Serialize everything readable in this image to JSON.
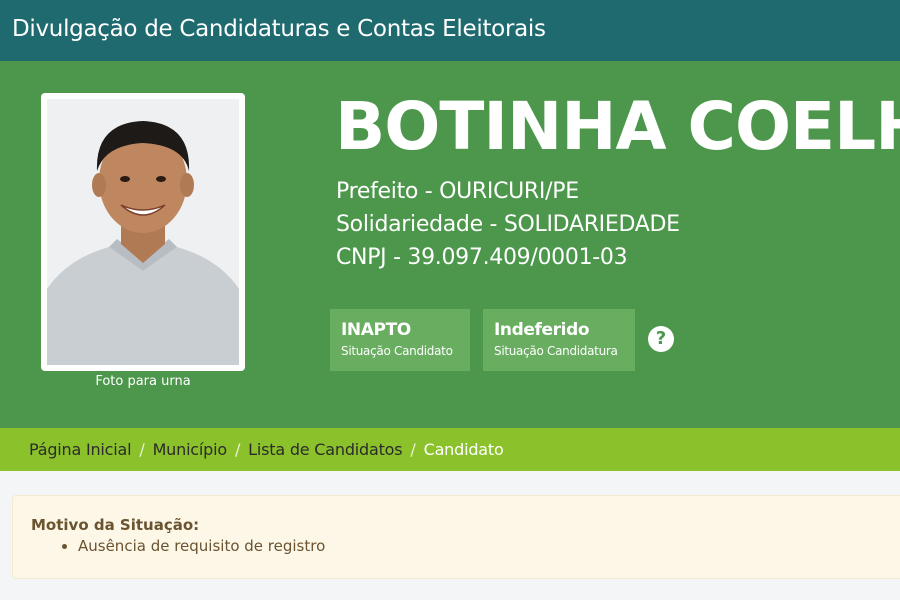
{
  "header": {
    "title": "Divulgação de Candidaturas e Contas Eleitorais"
  },
  "candidate": {
    "name": "BOTINHA COELHO",
    "office_line": "Prefeito - OURICURI/PE",
    "party_line": "Solidariedade - SOLIDARIEDADE",
    "cnpj_line": "CNPJ - 39.097.409/0001-03",
    "photo_caption": "Foto para urna"
  },
  "status": {
    "candidate": {
      "value": "INAPTO",
      "label": "Situação Candidato"
    },
    "candidacy": {
      "value": "Indeferido",
      "label": "Situação Candidatura"
    },
    "help_symbol": "?"
  },
  "breadcrumb": {
    "items": [
      {
        "label": "Página Inicial"
      },
      {
        "label": "Município"
      },
      {
        "label": "Lista de Candidatos"
      },
      {
        "label": "Candidato"
      }
    ],
    "separator": "/"
  },
  "notice": {
    "title": "Motivo da Situação:",
    "items": [
      "Ausência de requisito de registro"
    ]
  },
  "colors": {
    "topbar": "#1e6a6f",
    "hero": "#4c974b",
    "status_card": "#69ad61",
    "breadcrumb": "#8bc12a",
    "notice_bg": "#fcf7e7"
  }
}
